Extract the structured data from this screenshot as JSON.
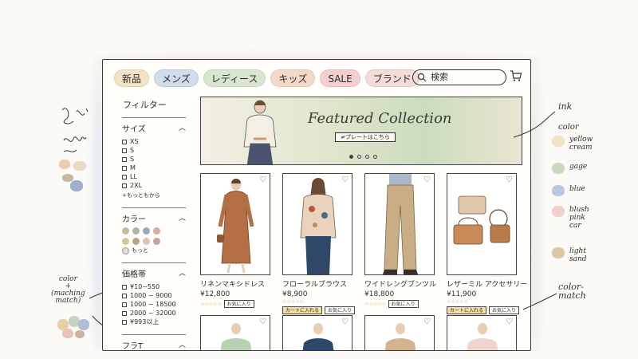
{
  "nav": {
    "items": [
      "新品",
      "メンズ",
      "レディース",
      "キッズ",
      "SALE",
      "ブランド"
    ],
    "colors": [
      "#f3e2c4",
      "#cfdcec",
      "#d8e6cf",
      "#f5d9c6",
      "#f5cfcf",
      "#f3dcd8"
    ]
  },
  "search": {
    "placeholder": "検索"
  },
  "sidebar": {
    "title": "フィルター",
    "size": {
      "label": "サイズ",
      "options": [
        "XS",
        "S",
        "S",
        "M",
        "LL",
        "2XL"
      ],
      "more": "+もっともから"
    },
    "color": {
      "label": "カラー",
      "swatches": [
        "#c8b9a0",
        "#a9b6a1",
        "#9aa9c3",
        "#d9a9a0",
        "#d6c49a",
        "#b6a48d",
        "#e0c1b6",
        "#c6a2a2"
      ],
      "more": "もっと"
    },
    "price": {
      "label": "価格帯",
      "options": [
        "¥10~550",
        "1000 ~ 9000",
        "1000 ~ 18500",
        "2000 ~ 32000",
        "¥993以上"
      ]
    },
    "brand": {
      "label": "フラT"
    }
  },
  "hero": {
    "title": "Featured Collection",
    "button": "≠プレートはこちら",
    "slides": 4,
    "active": 0
  },
  "products": [
    {
      "name": "リネンマキシドレス",
      "price": "¥12,800",
      "stars": "☆☆☆☆☆",
      "add": "",
      "fav": "お気に入り"
    },
    {
      "name": "フローラルブラウス",
      "price": "¥8,900",
      "stars": "☆☆☆☆☆",
      "add": "カートに入れる",
      "fav": "お気に入り"
    },
    {
      "name": "ワイドレングブンツル",
      "price": "¥18,800",
      "stars": "☆☆☆☆☆",
      "add": "",
      "fav": "お気に入り"
    },
    {
      "name": "レザーミル アクセサリー",
      "price": "¥11,900",
      "stars": "☆☆☆☆☆",
      "add": "カートに入れる",
      "fav": "お気に入り"
    }
  ],
  "annotations": {
    "ink": "ink",
    "color_title": "color",
    "legend": [
      {
        "label": "yellow cream",
        "color": "#f1e2c3"
      },
      {
        "label": "gage",
        "color": "#c9d9bf"
      },
      {
        "label": "blue",
        "color": "#b9c8df"
      },
      {
        "label": "blush pink car",
        "color": "#f1cfcf"
      },
      {
        "label": "light sand",
        "color": "#dcc7a7"
      }
    ],
    "color_match": "color-\nmatch",
    "left_note": "color\n+\n(maching\nmatch)"
  }
}
